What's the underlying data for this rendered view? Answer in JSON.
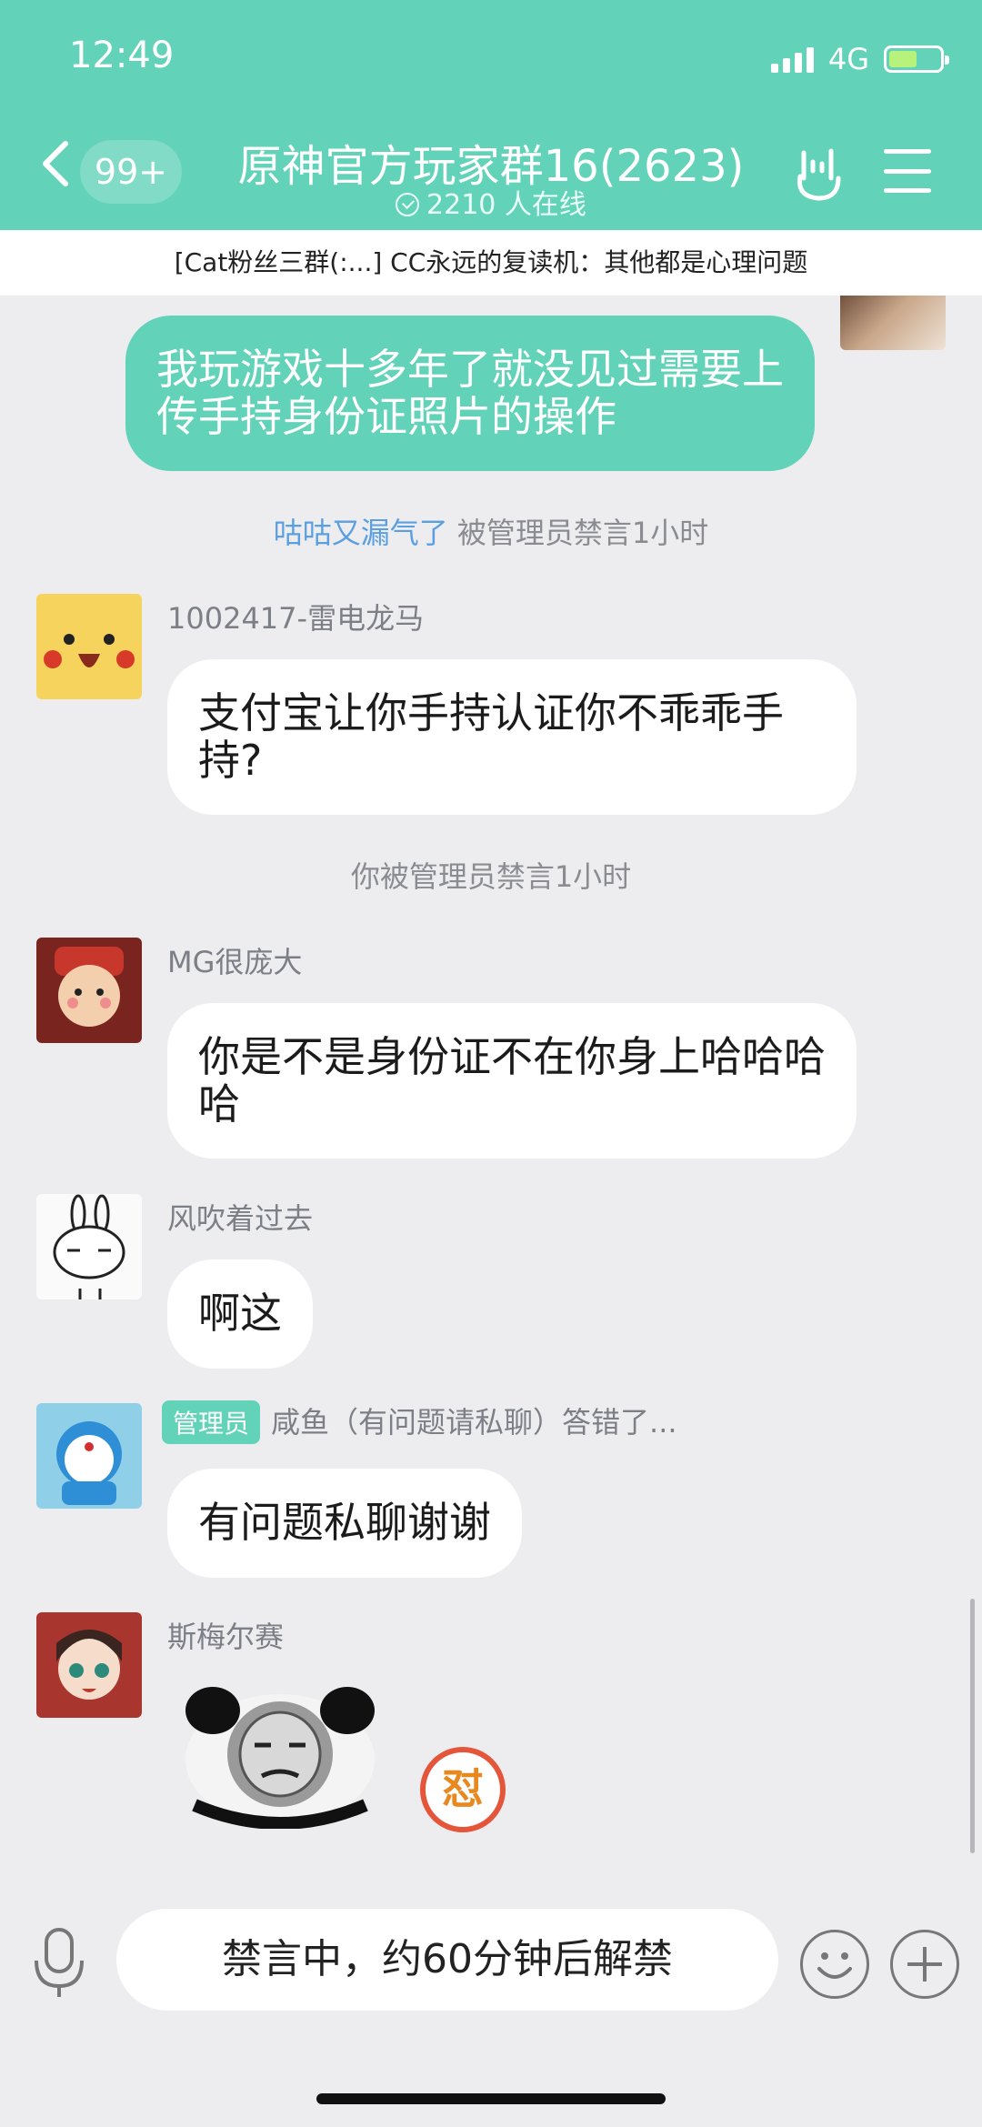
{
  "status": {
    "time": "12:49",
    "network": "4G",
    "battery_percent": 55
  },
  "header": {
    "unread_badge": "99+",
    "title": "原神官方玩家群16(2623)",
    "online": "2210 人在线"
  },
  "notice": "[Cat粉丝三群(:...] CC永远的复读机：其他都是心理问题",
  "messages": [
    {
      "type": "mine",
      "text": "我玩游戏十多年了就没见过需要上传手持身份证照片的操作"
    },
    {
      "type": "system",
      "link": "咕咕又漏气了",
      "text": " 被管理员禁言1小时"
    },
    {
      "type": "other",
      "sender": "1002417-雷电龙马",
      "text": "支付宝让你手持认证你不乖乖手持?"
    },
    {
      "type": "system",
      "text": "你被管理员禁言1小时"
    },
    {
      "type": "other",
      "sender": "MG很庞大",
      "text": "你是不是身份证不在你身上哈哈哈哈"
    },
    {
      "type": "other",
      "sender": "风吹着过去",
      "text": "啊这"
    },
    {
      "type": "other",
      "tag": "管理员",
      "sender": "咸鱼（有问题请私聊）答错了...",
      "text": "有问题私聊谢谢"
    },
    {
      "type": "other",
      "sender": "斯梅尔赛",
      "sticker_glyph": "怼"
    }
  ],
  "input": {
    "placeholder": "禁言中，约60分钟后解禁"
  },
  "icons": {
    "back": "chevron-left-icon",
    "hand": "rock-hand-icon",
    "menu": "menu-icon",
    "mic": "microphone-icon",
    "emoji": "smiley-icon",
    "plus": "plus-icon"
  },
  "colors": {
    "accent": "#62d2b8",
    "link": "#5a9fe0",
    "background": "#ededf0"
  }
}
